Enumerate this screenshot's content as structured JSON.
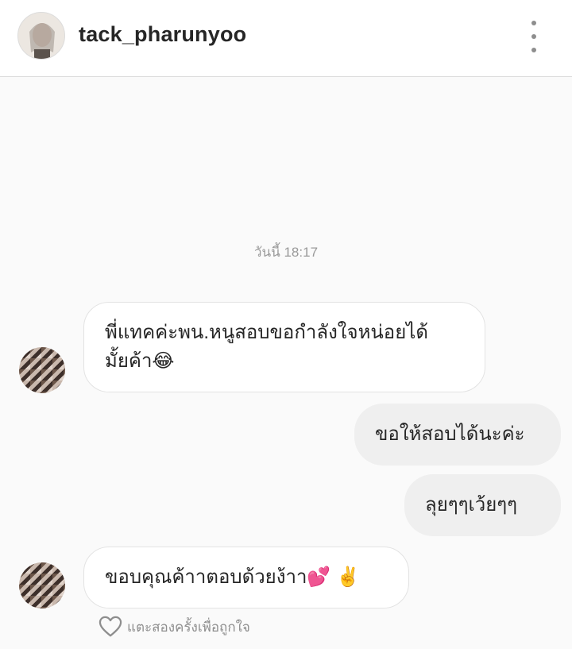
{
  "header": {
    "username": "tack_pharunyoo"
  },
  "chat": {
    "timestamp": "วันนี้ 18:17",
    "messages": [
      {
        "direction": "incoming",
        "text": "พี่แทคค่ะพน.หนูสอบขอกำลังใจหน่อยได้\nมั้ยค้า😂"
      },
      {
        "direction": "outgoing",
        "text": "ขอให้สอบได้นะค่ะ"
      },
      {
        "direction": "outgoing",
        "text": "ลุยๆๆเว้ยๆๆ"
      },
      {
        "direction": "incoming",
        "text": "ขอบคุณค้าาตอบด้วยง้าา💕 ✌️"
      }
    ],
    "like_hint": "แตะสองครั้งเพื่อถูกใจ"
  },
  "icons": {
    "menu": "more-vertical-icon",
    "like": "heart-outline-icon"
  }
}
